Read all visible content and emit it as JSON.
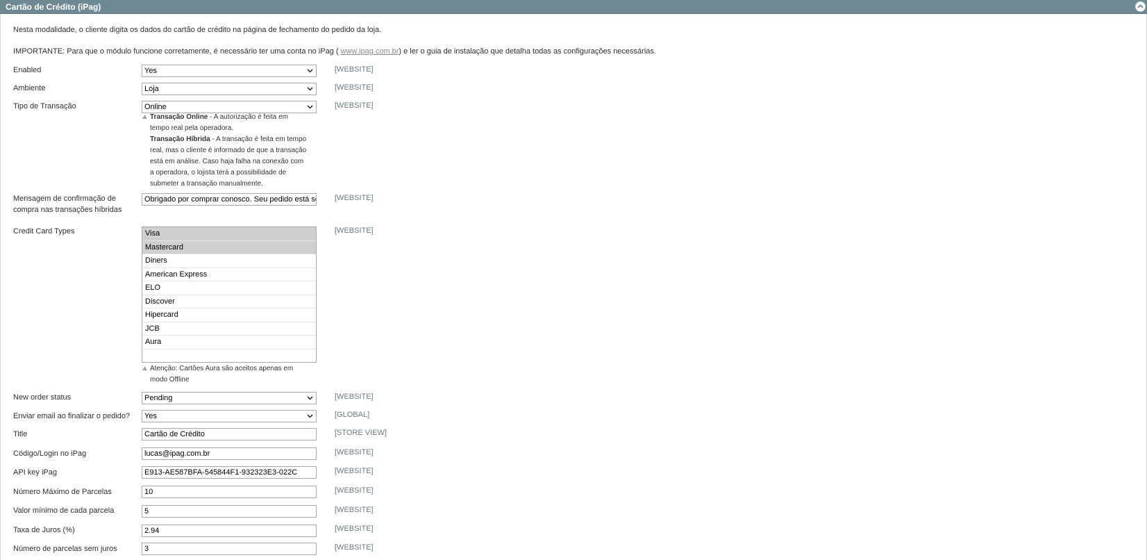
{
  "header": {
    "title": "Cartão de Crédito (iPag)",
    "collapse_icon": "chevron-up-icon"
  },
  "intro": {
    "line1": "Nesta modalidade, o cliente digita os dados do cartão de crédito na página de fechamento do pedido da loja.",
    "line2_before": "IMPORTANTE: Para que o módulo funcione corretamente, é necessário ter uma conta no iPag ( ",
    "line2_link": "www.ipag.com.br",
    "line2_after": ") e ler o guia de instalação que detalha todas as configurações necessárias."
  },
  "fields": {
    "enabled": {
      "label": "Enabled",
      "value": "Yes",
      "scope": "[WEBSITE]"
    },
    "ambiente": {
      "label": "Ambiente",
      "value": "Loja",
      "scope": "[WEBSITE]"
    },
    "tipo": {
      "label": "Tipo de Transação",
      "value": "Online",
      "scope": "[WEBSITE]",
      "hint_online_title": "Transação Online",
      "hint_online_line1": " - A autorização é feita em",
      "hint_online_line2": "tempo real pela operadora.",
      "hint_hibrida_title": "Transação Híbrida",
      "hint_hibrida_line1": " - A transação é feita em tempo",
      "hint_hibrida_line2": "real, mas o cliente é informado de que a transação",
      "hint_hibrida_line3": "está em análise. Caso haja falha na conexão com",
      "hint_hibrida_line4": "a operadora, o lojista terá a possibilidade de",
      "hint_hibrida_line5": "submeter a transação manualmente."
    },
    "mensagem": {
      "label_line1": "Mensagem de confirmação de",
      "label_line2": "compra nas transações híbridas",
      "value": "Obrigado por comprar conosco. Seu pedido está se",
      "scope": "[WEBSITE]"
    },
    "cc_types": {
      "label": "Credit Card Types",
      "scope": "[WEBSITE]",
      "options": [
        "Visa",
        "Mastercard",
        "Diners",
        "American Express",
        "ELO",
        "Discover",
        "Hipercard",
        "JCB",
        "Aura"
      ],
      "hint_line1": "Atenção: Cartões Aura são aceitos apenas em",
      "hint_line2": "modo Offline"
    },
    "new_order_status": {
      "label": "New order status",
      "value": "Pending",
      "scope": "[WEBSITE]"
    },
    "enviar_email": {
      "label": "Enviar email ao finalizar o pedido?",
      "value": "Yes",
      "scope": "[GLOBAL]"
    },
    "title": {
      "label": "Title",
      "value": "Cartão de Crédito",
      "scope": "[STORE VIEW]"
    },
    "login": {
      "label": "Código/Login no iPag",
      "value": "lucas@ipag.com.br",
      "scope": "[WEBSITE]"
    },
    "api_key": {
      "label": "API key iPag",
      "value": "E913-AE587BFA-545844F1-932323E3-022C",
      "scope": "[WEBSITE]"
    },
    "max_parcelas": {
      "label": "Número Máximo de Parcelas",
      "value": "10",
      "scope": "[WEBSITE]"
    },
    "valor_minimo": {
      "label": "Valor mínimo de cada parcela",
      "value": "5",
      "scope": "[WEBSITE]"
    },
    "taxa_juros": {
      "label": "Taxa de Juros (%)",
      "value": "2.94",
      "scope": "[WEBSITE]"
    },
    "parcelas_sem_juros": {
      "label": "Número de parcelas sem juros",
      "value": "3",
      "scope": "[WEBSITE]"
    }
  }
}
